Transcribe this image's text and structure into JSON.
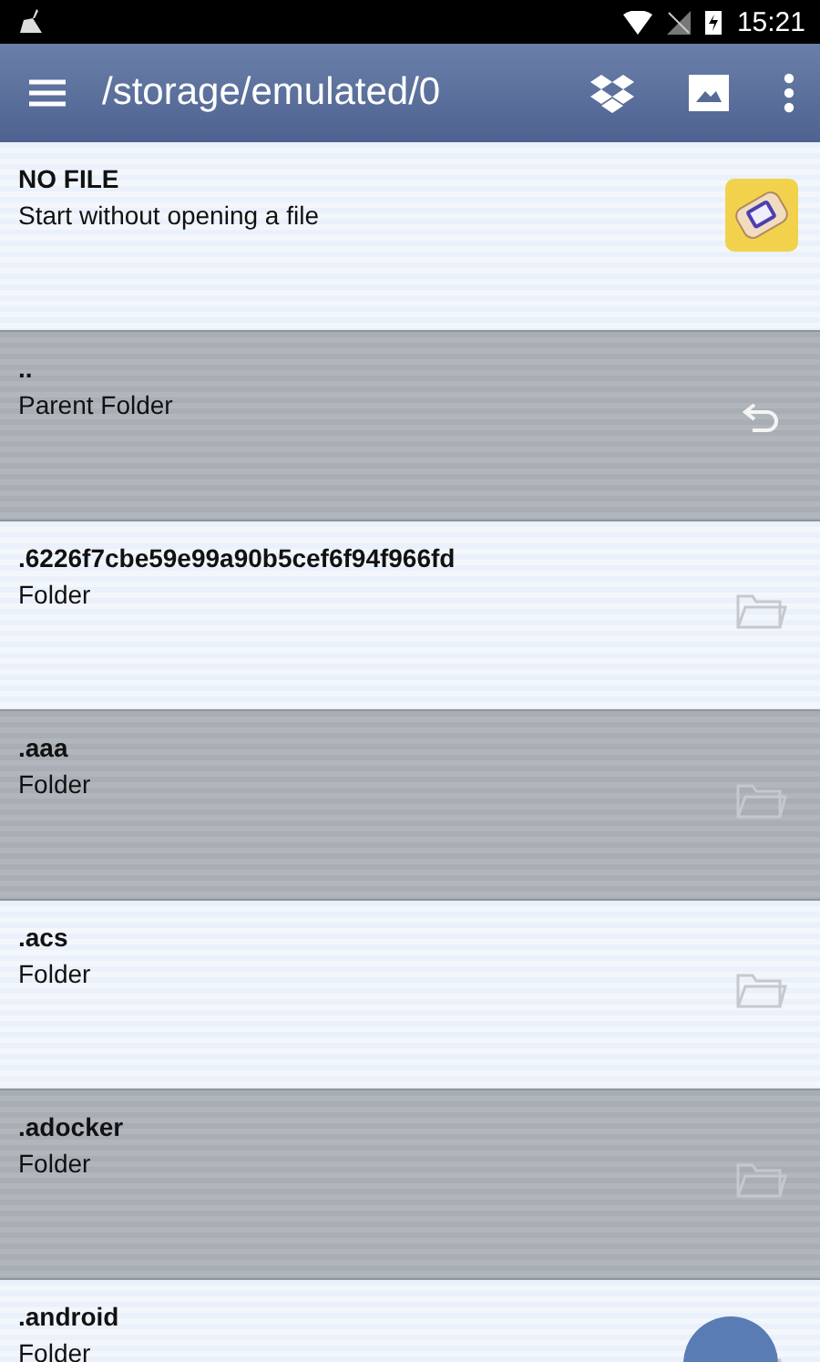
{
  "status_bar": {
    "time": "15:21"
  },
  "toolbar": {
    "title": "/storage/emulated/0"
  },
  "rows": [
    {
      "name": "NO FILE",
      "detail": "Start without opening a file",
      "kind": "game"
    },
    {
      "name": "..",
      "detail": "Parent Folder",
      "kind": "parent"
    },
    {
      "name": ".6226f7cbe59e99a90b5cef6f94f966fd",
      "detail": "Folder",
      "kind": "folder"
    },
    {
      "name": ".aaa",
      "detail": "Folder",
      "kind": "folder"
    },
    {
      "name": ".acs",
      "detail": "Folder",
      "kind": "folder"
    },
    {
      "name": ".adocker",
      "detail": "Folder",
      "kind": "folder"
    },
    {
      "name": ".android",
      "detail": "Folder",
      "kind": "folder"
    }
  ]
}
